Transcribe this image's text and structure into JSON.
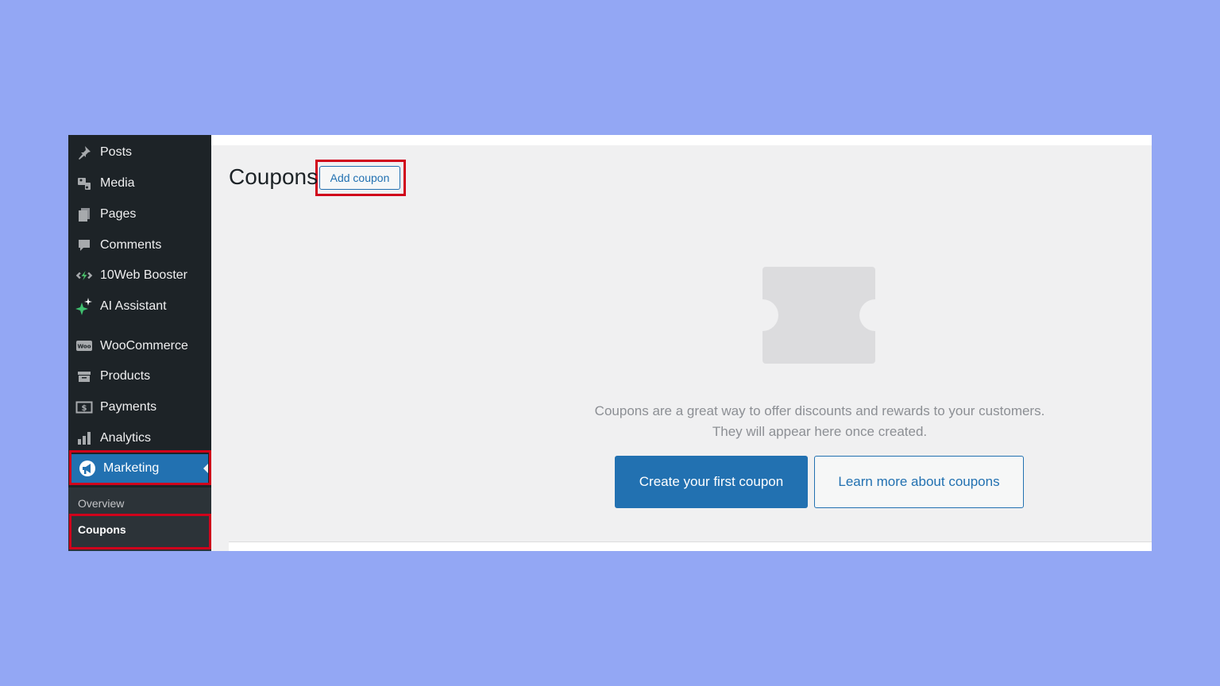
{
  "sidebar": {
    "items": [
      {
        "label": "Posts",
        "icon": "pin-icon"
      },
      {
        "label": "Media",
        "icon": "media-icon"
      },
      {
        "label": "Pages",
        "icon": "pages-icon"
      },
      {
        "label": "Comments",
        "icon": "comment-icon"
      },
      {
        "label": "10Web Booster",
        "icon": "booster-icon"
      },
      {
        "label": "AI Assistant",
        "icon": "sparkle-icon"
      },
      {
        "label": "WooCommerce",
        "icon": "woo-icon"
      },
      {
        "label": "Products",
        "icon": "archive-icon"
      },
      {
        "label": "Payments",
        "icon": "payments-icon"
      },
      {
        "label": "Analytics",
        "icon": "bar-chart-icon"
      },
      {
        "label": "Marketing",
        "icon": "megaphone-icon",
        "active": true
      }
    ],
    "submenu": [
      {
        "label": "Overview"
      },
      {
        "label": "Coupons",
        "current": true
      }
    ]
  },
  "main": {
    "title": "Coupons",
    "add_button": "Add coupon",
    "empty_message": "Coupons are a great way to offer discounts and rewards to your customers. They will appear here once created.",
    "primary_button": "Create your first coupon",
    "secondary_button": "Learn more about coupons"
  },
  "colors": {
    "background": "#93a7f4",
    "sidebar": "#1d2327",
    "accent": "#2271b1",
    "highlight": "#d0021b"
  }
}
